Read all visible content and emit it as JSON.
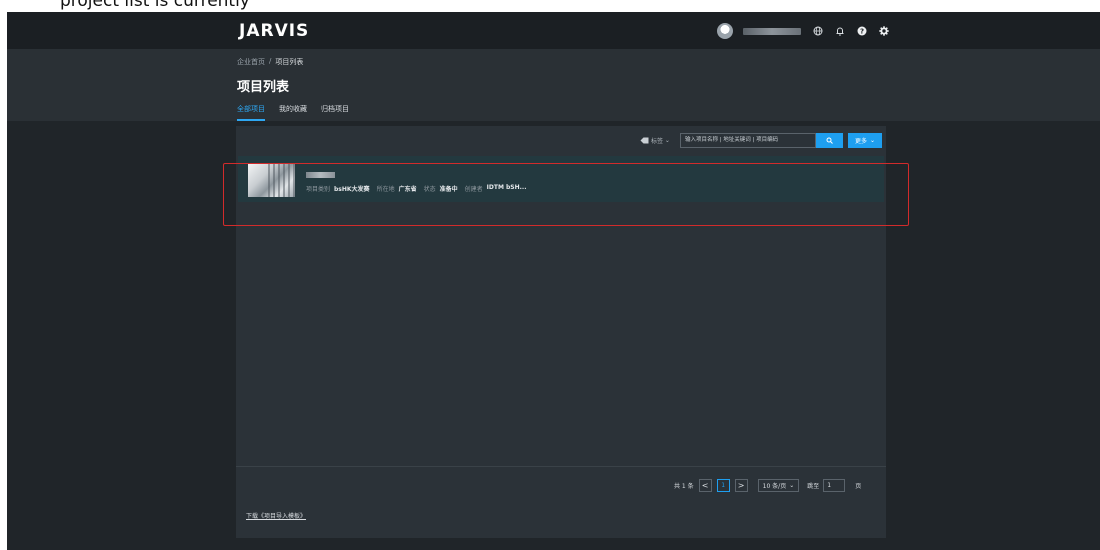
{
  "caption": {
    "text": "project list is currently"
  },
  "navbar": {
    "logo": "JARVIS",
    "icons": [
      "avatar",
      "globe-icon",
      "bell-icon",
      "help-icon",
      "gear-icon"
    ]
  },
  "header": {
    "breadcrumb": {
      "home": "企业首页",
      "separator": "/",
      "current": "项目列表"
    },
    "title": "项目列表",
    "tabs": [
      {
        "label": "全部项目",
        "active": true
      },
      {
        "label": "我的收藏",
        "active": false
      },
      {
        "label": "归档项目",
        "active": false
      }
    ]
  },
  "toolbar": {
    "tag_label": "标签",
    "search_placeholder": "输入项目名称 | 地址关键词 | 项目编码",
    "more_label": "更多"
  },
  "projects": [
    {
      "category_label": "项目类别",
      "category": "bsHK大发赛",
      "location_label": "所在地",
      "location": "广东省",
      "status_label": "状态",
      "status": "准备中",
      "creator_label": "创建者",
      "creator": "IDTM bSH..."
    }
  ],
  "pagination": {
    "total": "共 1 条",
    "prev": "<",
    "current_page": "1",
    "next": ">",
    "page_size": "10 条/页",
    "goto_label": "跳至",
    "goto_value": "1",
    "page_unit": "页"
  },
  "footer": {
    "download_link": "下载《项目导入模板》"
  },
  "colors": {
    "accent": "#1e9ff0",
    "highlight_border": "#d22b2b",
    "card_background": "#23393f",
    "panel_background": "#2b3238"
  }
}
